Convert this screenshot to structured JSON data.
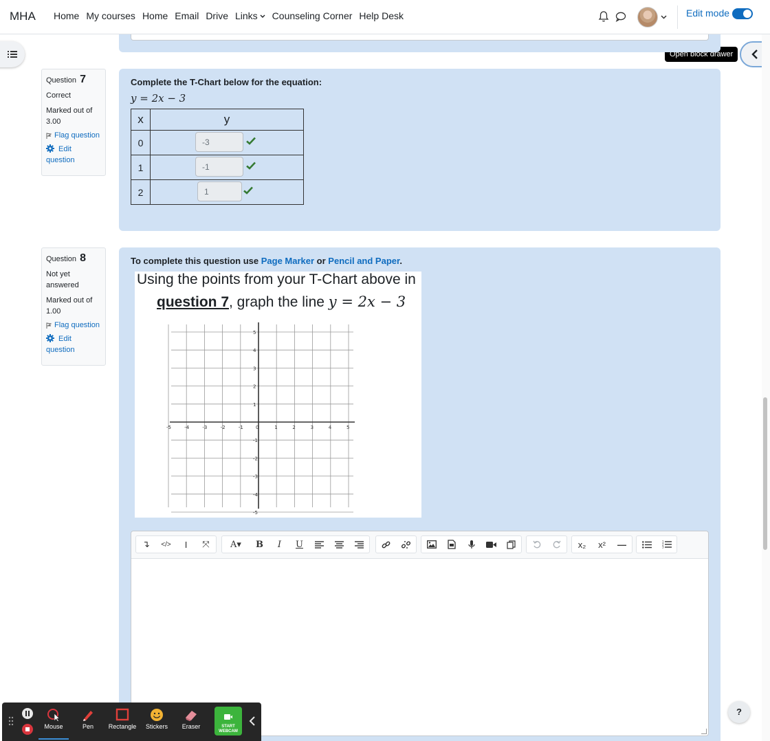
{
  "nav": {
    "brand": "MHA",
    "links": [
      "Home",
      "My courses",
      "Home",
      "Email",
      "Drive",
      "Links",
      "Counseling Corner",
      "Help Desk"
    ],
    "links_caret": "⌄",
    "edit_mode_label": "Edit mode",
    "edit_mode_on": true
  },
  "drawer": {
    "tooltip": "Open block drawer"
  },
  "q7": {
    "label": "Question",
    "number": "7",
    "state": "Correct",
    "marked": "Marked out of 3.00",
    "flag": "Flag question",
    "edit": "Edit question",
    "prompt": "Complete the T-Chart below for the equation:",
    "equation": "y = 2x − 3",
    "table": {
      "x_header": "x",
      "y_header": "y",
      "rows": [
        {
          "x": "0",
          "y": "-3"
        },
        {
          "x": "1",
          "y": "-1"
        },
        {
          "x": "2",
          "y": "1"
        }
      ]
    }
  },
  "q8": {
    "label": "Question",
    "number": "8",
    "state": "Not yet answered",
    "marked": "Marked out of 1.00",
    "flag": "Flag question",
    "edit": "Edit question",
    "prompt_prefix": "To complete this question use ",
    "link1": "Page Marker",
    "prompt_or": " or ",
    "link2": "Pencil and Paper",
    "prompt_suffix": ".",
    "image_line1": "Using the points from your T-Chart above in",
    "image_line2_link": "question 7",
    "image_line2_text": ", graph the line ",
    "image_equation": "y = 2x − 3",
    "grid": {
      "x_ticks": [
        "-5",
        "-4",
        "-3",
        "-2",
        "-1",
        "0",
        "1",
        "2",
        "3",
        "4",
        "5"
      ],
      "y_ticks": [
        "5",
        "4",
        "3",
        "2",
        "1",
        "-1",
        "-2",
        "-3",
        "-4",
        "-5"
      ]
    }
  },
  "editor": {
    "toolbar_groups": [
      [
        "↴",
        "</>",
        "I",
        "⤧"
      ],
      [
        "A▾",
        "B",
        "I",
        "U",
        "≡L",
        "≡C",
        "≡R"
      ],
      [
        "link",
        "unlink"
      ],
      [
        "image",
        "media",
        "mic",
        "video",
        "copy"
      ],
      [
        "undo",
        "redo"
      ],
      [
        "x₂",
        "x²",
        "—"
      ],
      [
        "ul",
        "ol"
      ]
    ]
  },
  "castbar": {
    "tools": [
      "Mouse",
      "Pen",
      "Rectangle",
      "Stickers",
      "Eraser"
    ],
    "webcam": "START WEBCAM"
  },
  "help_label": "?",
  "colors": {
    "accent": "#0f6cbf",
    "question_bg": "#d0e1f4",
    "correct_check": "#357a32"
  }
}
